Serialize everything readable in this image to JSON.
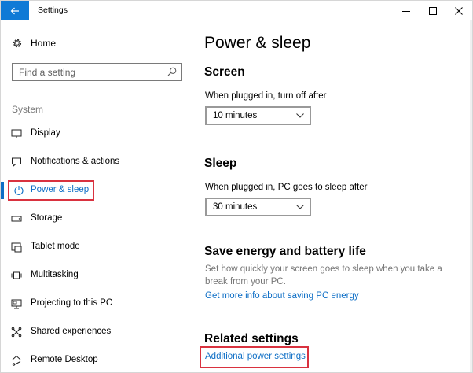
{
  "titlebar": {
    "title": "Settings",
    "back_icon": "back-arrow-icon",
    "minimize_icon": "minimize-icon",
    "maximize_icon": "maximize-icon",
    "close_icon": "close-icon"
  },
  "sidebar": {
    "home_label": "Home",
    "home_icon": "gear-icon",
    "search": {
      "placeholder": "Find a setting",
      "value": "",
      "icon": "search-icon"
    },
    "group_label": "System",
    "items": [
      {
        "label": "Display",
        "icon": "display-icon",
        "active": false
      },
      {
        "label": "Notifications & actions",
        "icon": "notifications-icon",
        "active": false
      },
      {
        "label": "Power & sleep",
        "icon": "power-icon",
        "active": true,
        "highlighted": true
      },
      {
        "label": "Storage",
        "icon": "storage-icon",
        "active": false
      },
      {
        "label": "Tablet mode",
        "icon": "tablet-mode-icon",
        "active": false
      },
      {
        "label": "Multitasking",
        "icon": "multitasking-icon",
        "active": false
      },
      {
        "label": "Projecting to this PC",
        "icon": "projecting-icon",
        "active": false
      },
      {
        "label": "Shared experiences",
        "icon": "shared-experiences-icon",
        "active": false
      },
      {
        "label": "Remote Desktop",
        "icon": "remote-desktop-icon",
        "active": false
      }
    ]
  },
  "main": {
    "title": "Power & sleep",
    "screen": {
      "heading": "Screen",
      "label": "When plugged in, turn off after",
      "value": "10 minutes"
    },
    "sleep": {
      "heading": "Sleep",
      "label": "When plugged in, PC goes to sleep after",
      "value": "30 minutes"
    },
    "energy": {
      "heading": "Save energy and battery life",
      "description": "Set how quickly your screen goes to sleep when you take a break from your PC.",
      "link": "Get more info about saving PC energy"
    },
    "related": {
      "heading": "Related settings",
      "link": "Additional power settings",
      "highlighted": true
    }
  },
  "colors": {
    "accent": "#0f6fc6",
    "titlebar_back": "#0f7ad6",
    "highlight_box": "#d9323f",
    "muted_text": "#767676"
  }
}
